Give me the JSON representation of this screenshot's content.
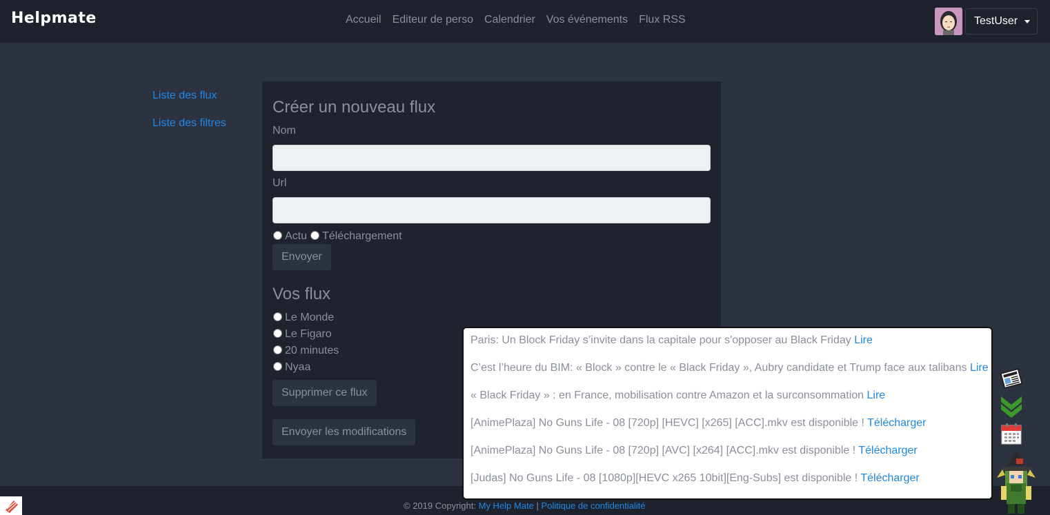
{
  "navbar": {
    "brand": "Helpmate",
    "links": [
      "Accueil",
      "Editeur de perso",
      "Calendrier",
      "Vos événements",
      "Flux RSS"
    ],
    "user": "TestUser"
  },
  "sidebar": {
    "items": [
      "Liste des flux",
      "Liste des filtres"
    ]
  },
  "create_form": {
    "title": "Créer un nouveau flux",
    "name_label": "Nom",
    "name_value": "",
    "url_label": "Url",
    "url_value": "",
    "type_options": [
      "Actu",
      "Téléchargement"
    ],
    "submit_label": "Envoyer"
  },
  "feeds": {
    "title": "Vos flux",
    "items": [
      "Le Monde",
      "Le Figaro",
      "20 minutes",
      "Nyaa"
    ],
    "delete_label": "Supprimer ce flux",
    "save_label": "Envoyer les modifications"
  },
  "notifications": [
    {
      "text": "Paris: Un Block Friday s’invite dans la capitale pour s'opposer au Black Friday",
      "action": "Lire"
    },
    {
      "text": "C’est l’heure du BIM: « Block » contre le « Black Friday », Aubry candidate et Trump face aux talibans",
      "action": "Lire"
    },
    {
      "text": "« Black Friday » : en France, mobilisation contre Amazon et la surconsommation",
      "action": "Lire"
    },
    {
      "text": "[AnimePlaza] No Guns Life - 08 [720p] [HEVC] [x265] [ACC].mkv est disponible !",
      "action": "Télécharger"
    },
    {
      "text": "[AnimePlaza] No Guns Life - 08 [720p] [AVC] [x264] [ACC].mkv est disponible !",
      "action": "Télécharger"
    },
    {
      "text": "[Judas] No Guns Life - 08 [1080p][HEVC x265 10bit][Eng-Subs] est disponible !",
      "action": "Télécharger"
    }
  ],
  "footer": {
    "copyright": "© 2019 Copyright:",
    "site_link": "My Help Mate",
    "separator": "|",
    "privacy_link": "Politique de confidentialité"
  },
  "icons": {
    "avatar": "avatar-icon",
    "news": "newspaper-icon",
    "download": "double-chevron-down-icon",
    "calendar": "calendar-icon",
    "mascot": "wizard-mascot-icon",
    "corner": "app-logo-icon"
  },
  "colors": {
    "background": "#2d3240",
    "navbar": "#1e222c",
    "card": "#1f232e",
    "link": "#1e88e5",
    "text": "#8a8f99"
  }
}
